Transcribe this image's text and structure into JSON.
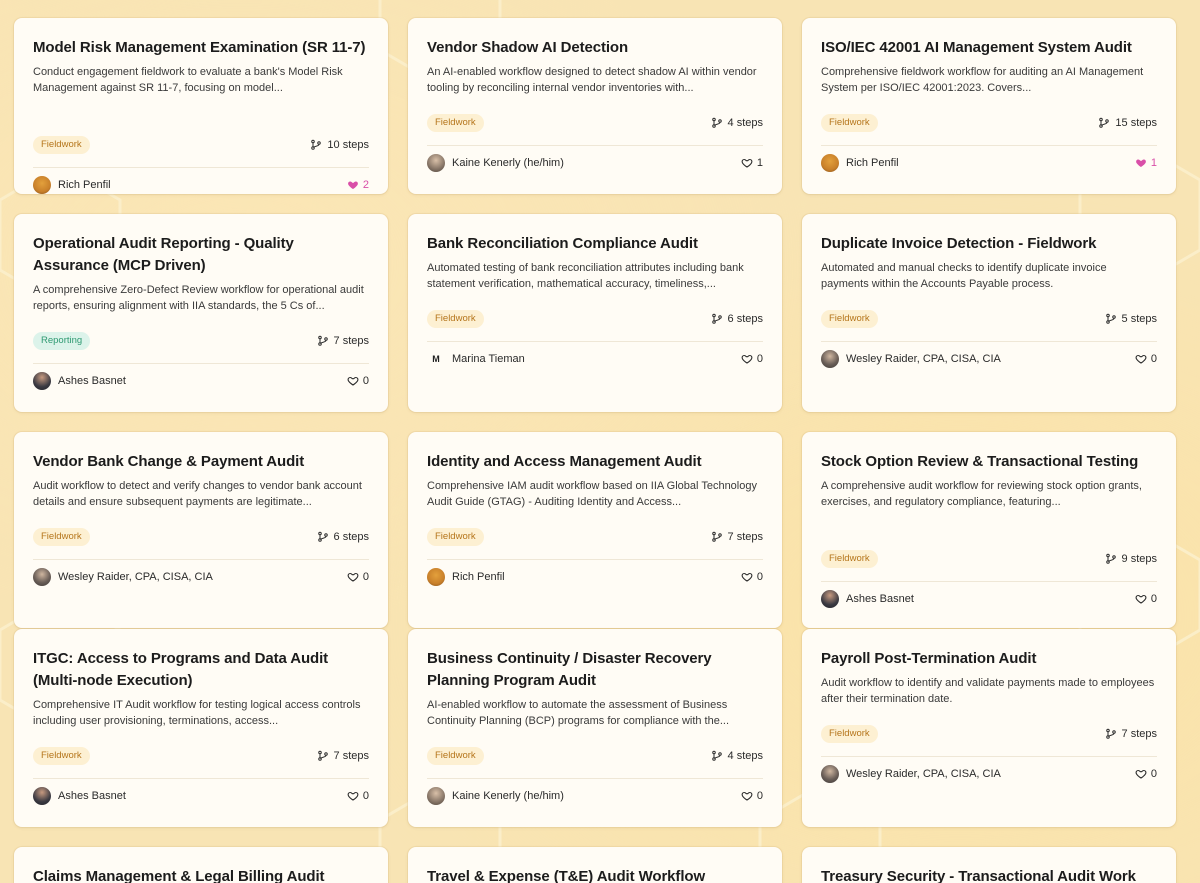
{
  "colors": {
    "background": "#f8e4b4",
    "card": "#fffcf5",
    "fieldwork_tag_bg": "#fdf0d2",
    "fieldwork_tag_text": "#b5751b",
    "reporting_tag_bg": "#dcf3ea",
    "reporting_tag_text": "#2f9a72",
    "liked_heart": "#d94fa8"
  },
  "icons": {
    "steps": "git-branch-icon",
    "likes": "heart-icon"
  },
  "cards": [
    {
      "title": "Model Risk Management Examination (SR 11-7)",
      "description": "Conduct engagement fieldwork to evaluate a bank's Model Risk Management against SR 11-7, focusing on model...",
      "tag": "Fieldwork",
      "steps": "10 steps",
      "author": "Rich Penfil",
      "likes": "2",
      "liked": true
    },
    {
      "title": "Vendor Shadow AI Detection",
      "description": "An AI-enabled workflow designed to detect shadow AI within vendor tooling by reconciling internal vendor inventories with...",
      "tag": "Fieldwork",
      "steps": "4 steps",
      "author": "Kaine Kenerly (he/him)",
      "likes": "1",
      "liked": false
    },
    {
      "title": "ISO/IEC 42001 AI Management System Audit",
      "description": "Comprehensive fieldwork workflow for auditing an AI Management System per ISO/IEC 42001:2023. Covers...",
      "tag": "Fieldwork",
      "steps": "15 steps",
      "author": "Rich Penfil",
      "likes": "1",
      "liked": true
    },
    {
      "title": "Operational Audit Reporting - Quality Assurance (MCP Driven)",
      "description": "A comprehensive Zero-Defect Review workflow for operational audit reports, ensuring alignment with IIA standards, the 5 Cs of...",
      "tag": "Reporting",
      "steps": "7 steps",
      "author": "Ashes Basnet",
      "likes": "0",
      "liked": false
    },
    {
      "title": "Bank Reconciliation Compliance Audit",
      "description": "Automated testing of bank reconciliation attributes including bank statement verification, mathematical accuracy, timeliness,...",
      "tag": "Fieldwork",
      "steps": "6 steps",
      "author": "Marina Tieman",
      "avatar_initial": "M",
      "likes": "0",
      "liked": false
    },
    {
      "title": "Duplicate Invoice Detection - Fieldwork",
      "description": "Automated and manual checks to identify duplicate invoice payments within the Accounts Payable process.",
      "tag": "Fieldwork",
      "steps": "5 steps",
      "author": "Wesley Raider, CPA, CISA, CIA",
      "likes": "0",
      "liked": false
    },
    {
      "title": "Vendor Bank Change & Payment Audit",
      "description": "Audit workflow to detect and verify changes to vendor bank account details and ensure subsequent payments are legitimate...",
      "tag": "Fieldwork",
      "steps": "6 steps",
      "author": "Wesley Raider, CPA, CISA, CIA",
      "likes": "0",
      "liked": false
    },
    {
      "title": "Identity and Access Management Audit",
      "description": "Comprehensive IAM audit workflow based on IIA Global Technology Audit Guide (GTAG) - Auditing Identity and Access...",
      "tag": "Fieldwork",
      "steps": "7 steps",
      "author": "Rich Penfil",
      "likes": "0",
      "liked": false
    },
    {
      "title": "Stock Option Review & Transactional Testing",
      "description": "A comprehensive audit workflow for reviewing stock option grants, exercises, and regulatory compliance, featuring...",
      "tag": "Fieldwork",
      "steps": "9 steps",
      "author": "Ashes Basnet",
      "likes": "0",
      "liked": false
    },
    {
      "title": "ITGC: Access to Programs and Data Audit (Multi-node Execution)",
      "description": "Comprehensive IT Audit workflow for testing logical access controls including user provisioning, terminations, access...",
      "tag": "Fieldwork",
      "steps": "7 steps",
      "author": "Ashes Basnet",
      "likes": "0",
      "liked": false
    },
    {
      "title": "Business Continuity / Disaster Recovery Planning Program Audit",
      "description": "AI-enabled workflow to automate the assessment of Business Continuity Planning (BCP) programs for compliance with the...",
      "tag": "Fieldwork",
      "steps": "4 steps",
      "author": "Kaine Kenerly (he/him)",
      "likes": "0",
      "liked": false
    },
    {
      "title": "Payroll Post-Termination Audit",
      "description": "Audit workflow to identify and validate payments made to employees after their termination date.",
      "tag": "Fieldwork",
      "steps": "7 steps",
      "author": "Wesley Raider, CPA, CISA, CIA",
      "likes": "0",
      "liked": false
    },
    {
      "title": "Claims Management & Legal Billing Audit"
    },
    {
      "title": "Travel & Expense (T&E) Audit Workflow"
    },
    {
      "title": "Treasury Security - Transactional Audit Work"
    }
  ]
}
